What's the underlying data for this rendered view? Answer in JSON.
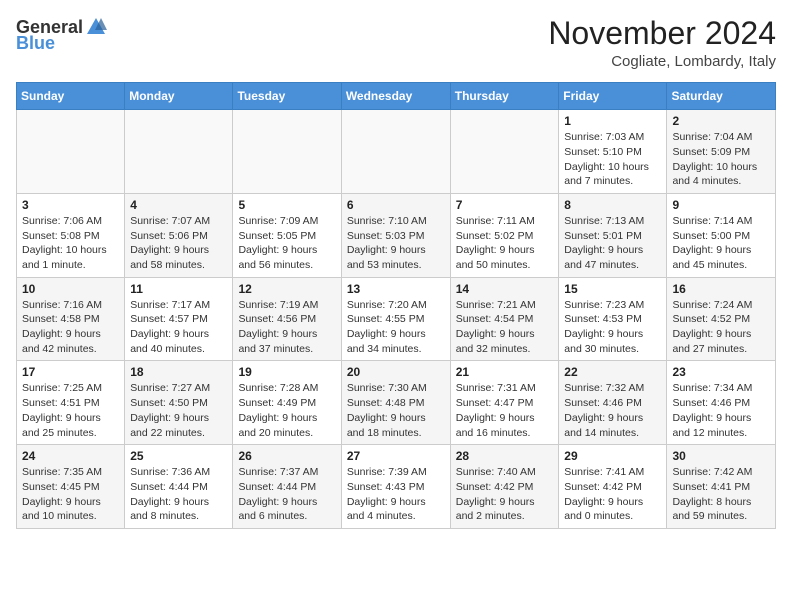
{
  "logo": {
    "general": "General",
    "blue": "Blue"
  },
  "header": {
    "month": "November 2024",
    "location": "Cogliate, Lombardy, Italy"
  },
  "weekdays": [
    "Sunday",
    "Monday",
    "Tuesday",
    "Wednesday",
    "Thursday",
    "Friday",
    "Saturday"
  ],
  "weeks": [
    [
      {
        "day": "",
        "info": ""
      },
      {
        "day": "",
        "info": ""
      },
      {
        "day": "",
        "info": ""
      },
      {
        "day": "",
        "info": ""
      },
      {
        "day": "",
        "info": ""
      },
      {
        "day": "1",
        "info": "Sunrise: 7:03 AM\nSunset: 5:10 PM\nDaylight: 10 hours and 7 minutes."
      },
      {
        "day": "2",
        "info": "Sunrise: 7:04 AM\nSunset: 5:09 PM\nDaylight: 10 hours and 4 minutes."
      }
    ],
    [
      {
        "day": "3",
        "info": "Sunrise: 7:06 AM\nSunset: 5:08 PM\nDaylight: 10 hours and 1 minute."
      },
      {
        "day": "4",
        "info": "Sunrise: 7:07 AM\nSunset: 5:06 PM\nDaylight: 9 hours and 58 minutes."
      },
      {
        "day": "5",
        "info": "Sunrise: 7:09 AM\nSunset: 5:05 PM\nDaylight: 9 hours and 56 minutes."
      },
      {
        "day": "6",
        "info": "Sunrise: 7:10 AM\nSunset: 5:03 PM\nDaylight: 9 hours and 53 minutes."
      },
      {
        "day": "7",
        "info": "Sunrise: 7:11 AM\nSunset: 5:02 PM\nDaylight: 9 hours and 50 minutes."
      },
      {
        "day": "8",
        "info": "Sunrise: 7:13 AM\nSunset: 5:01 PM\nDaylight: 9 hours and 47 minutes."
      },
      {
        "day": "9",
        "info": "Sunrise: 7:14 AM\nSunset: 5:00 PM\nDaylight: 9 hours and 45 minutes."
      }
    ],
    [
      {
        "day": "10",
        "info": "Sunrise: 7:16 AM\nSunset: 4:58 PM\nDaylight: 9 hours and 42 minutes."
      },
      {
        "day": "11",
        "info": "Sunrise: 7:17 AM\nSunset: 4:57 PM\nDaylight: 9 hours and 40 minutes."
      },
      {
        "day": "12",
        "info": "Sunrise: 7:19 AM\nSunset: 4:56 PM\nDaylight: 9 hours and 37 minutes."
      },
      {
        "day": "13",
        "info": "Sunrise: 7:20 AM\nSunset: 4:55 PM\nDaylight: 9 hours and 34 minutes."
      },
      {
        "day": "14",
        "info": "Sunrise: 7:21 AM\nSunset: 4:54 PM\nDaylight: 9 hours and 32 minutes."
      },
      {
        "day": "15",
        "info": "Sunrise: 7:23 AM\nSunset: 4:53 PM\nDaylight: 9 hours and 30 minutes."
      },
      {
        "day": "16",
        "info": "Sunrise: 7:24 AM\nSunset: 4:52 PM\nDaylight: 9 hours and 27 minutes."
      }
    ],
    [
      {
        "day": "17",
        "info": "Sunrise: 7:25 AM\nSunset: 4:51 PM\nDaylight: 9 hours and 25 minutes."
      },
      {
        "day": "18",
        "info": "Sunrise: 7:27 AM\nSunset: 4:50 PM\nDaylight: 9 hours and 22 minutes."
      },
      {
        "day": "19",
        "info": "Sunrise: 7:28 AM\nSunset: 4:49 PM\nDaylight: 9 hours and 20 minutes."
      },
      {
        "day": "20",
        "info": "Sunrise: 7:30 AM\nSunset: 4:48 PM\nDaylight: 9 hours and 18 minutes."
      },
      {
        "day": "21",
        "info": "Sunrise: 7:31 AM\nSunset: 4:47 PM\nDaylight: 9 hours and 16 minutes."
      },
      {
        "day": "22",
        "info": "Sunrise: 7:32 AM\nSunset: 4:46 PM\nDaylight: 9 hours and 14 minutes."
      },
      {
        "day": "23",
        "info": "Sunrise: 7:34 AM\nSunset: 4:46 PM\nDaylight: 9 hours and 12 minutes."
      }
    ],
    [
      {
        "day": "24",
        "info": "Sunrise: 7:35 AM\nSunset: 4:45 PM\nDaylight: 9 hours and 10 minutes."
      },
      {
        "day": "25",
        "info": "Sunrise: 7:36 AM\nSunset: 4:44 PM\nDaylight: 9 hours and 8 minutes."
      },
      {
        "day": "26",
        "info": "Sunrise: 7:37 AM\nSunset: 4:44 PM\nDaylight: 9 hours and 6 minutes."
      },
      {
        "day": "27",
        "info": "Sunrise: 7:39 AM\nSunset: 4:43 PM\nDaylight: 9 hours and 4 minutes."
      },
      {
        "day": "28",
        "info": "Sunrise: 7:40 AM\nSunset: 4:42 PM\nDaylight: 9 hours and 2 minutes."
      },
      {
        "day": "29",
        "info": "Sunrise: 7:41 AM\nSunset: 4:42 PM\nDaylight: 9 hours and 0 minutes."
      },
      {
        "day": "30",
        "info": "Sunrise: 7:42 AM\nSunset: 4:41 PM\nDaylight: 8 hours and 59 minutes."
      }
    ]
  ]
}
